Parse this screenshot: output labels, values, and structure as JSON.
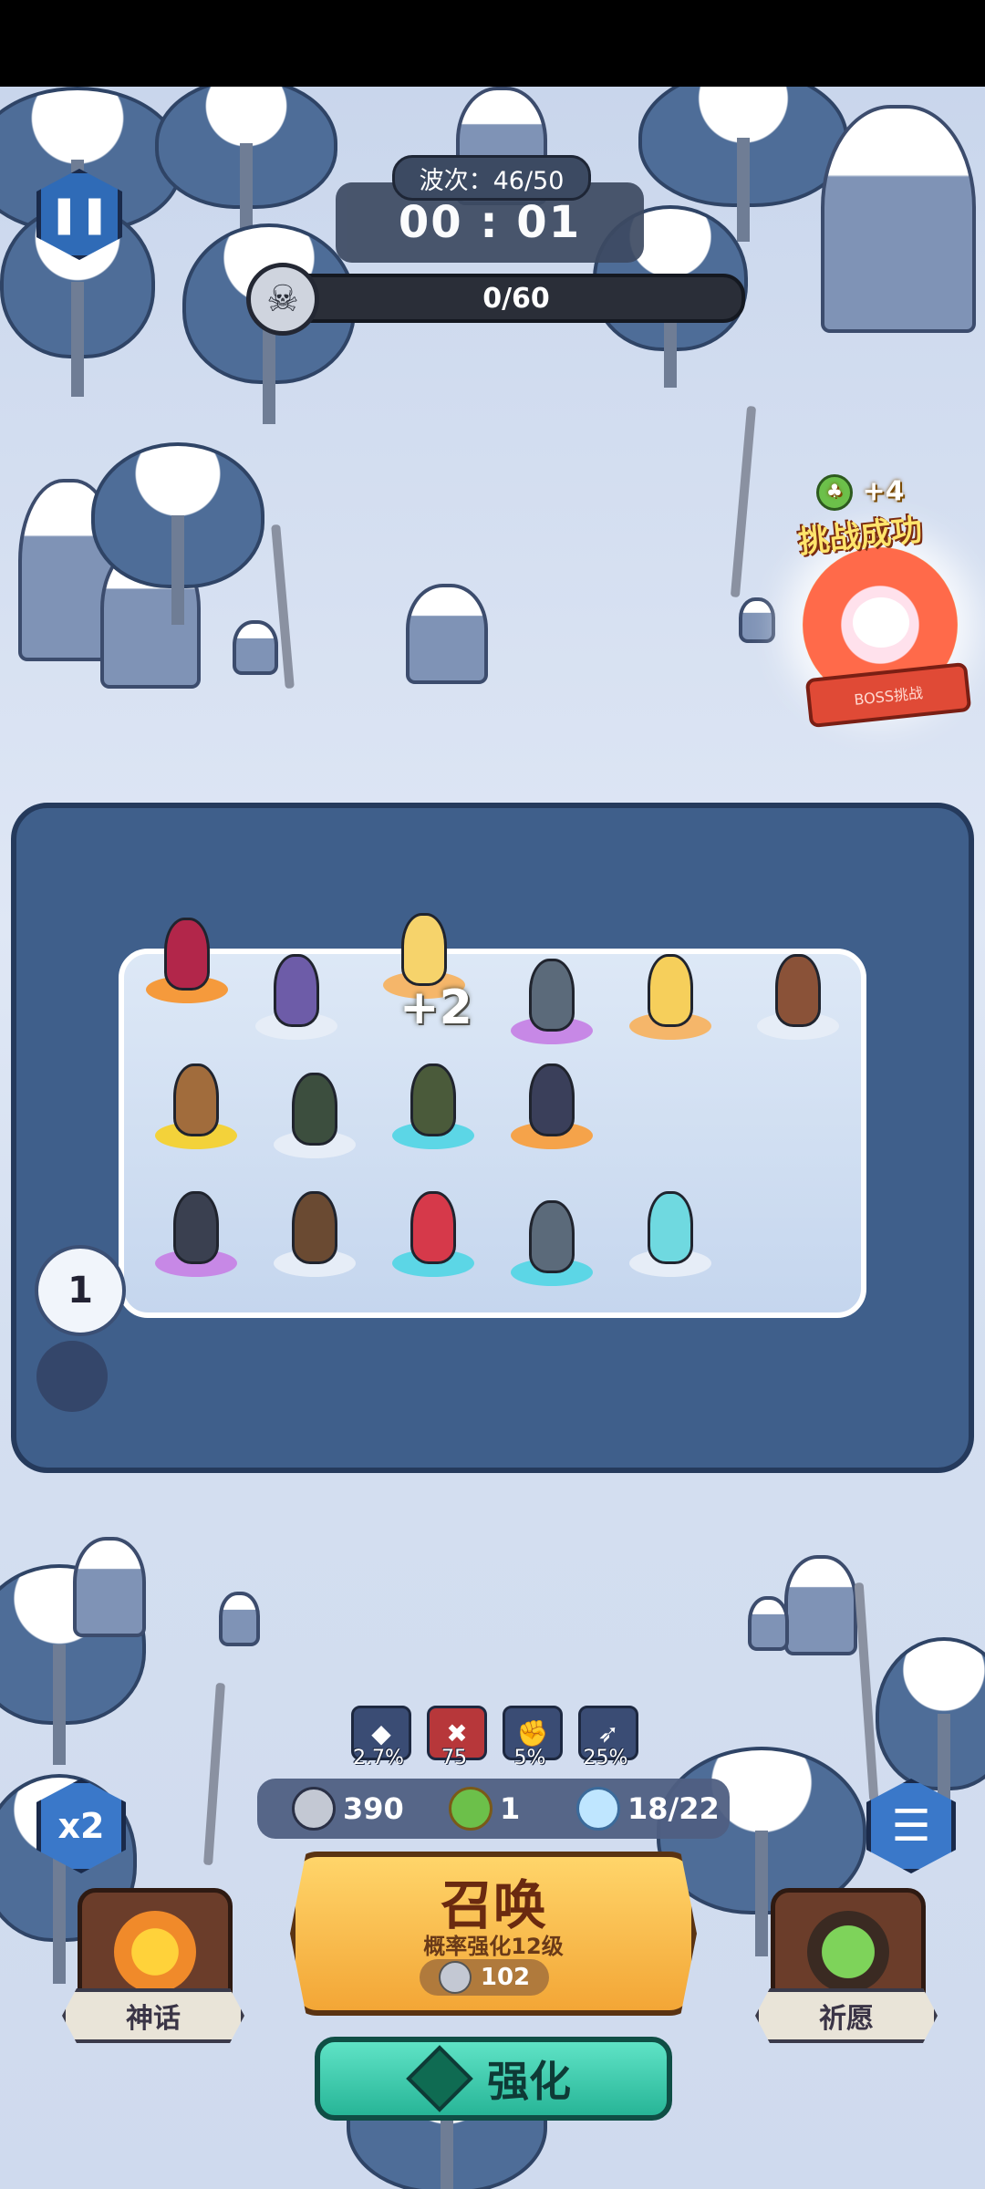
{
  "hud": {
    "wave_label": "波次：46/50",
    "timer": "00 : 01",
    "kills": "0/60"
  },
  "boss": {
    "reward": "+4",
    "success": "挑战成功",
    "banner": "BOSS挑战"
  },
  "battlefield": {
    "merge_popup": "+2",
    "slot_count": "1"
  },
  "stats": [
    {
      "icon": "crit-gem-icon",
      "value": "2.7%"
    },
    {
      "icon": "broken-shield-icon",
      "value": "75"
    },
    {
      "icon": "fist-upgrade-icon",
      "value": "5%"
    },
    {
      "icon": "arrow-upgrade-icon",
      "value": "25%"
    }
  ],
  "resources": {
    "silver": "390",
    "clover": "1",
    "population": "18/22"
  },
  "buttons": {
    "speed": "x2",
    "myth": "神话",
    "wish": "祈愿",
    "summon_title": "召唤",
    "summon_sub": "概率强化12级",
    "summon_cost": "102",
    "enhance": "强化"
  },
  "colors": {
    "summon": "#f3a636",
    "enhance": "#27b597",
    "moat": "#3f5f8b"
  }
}
